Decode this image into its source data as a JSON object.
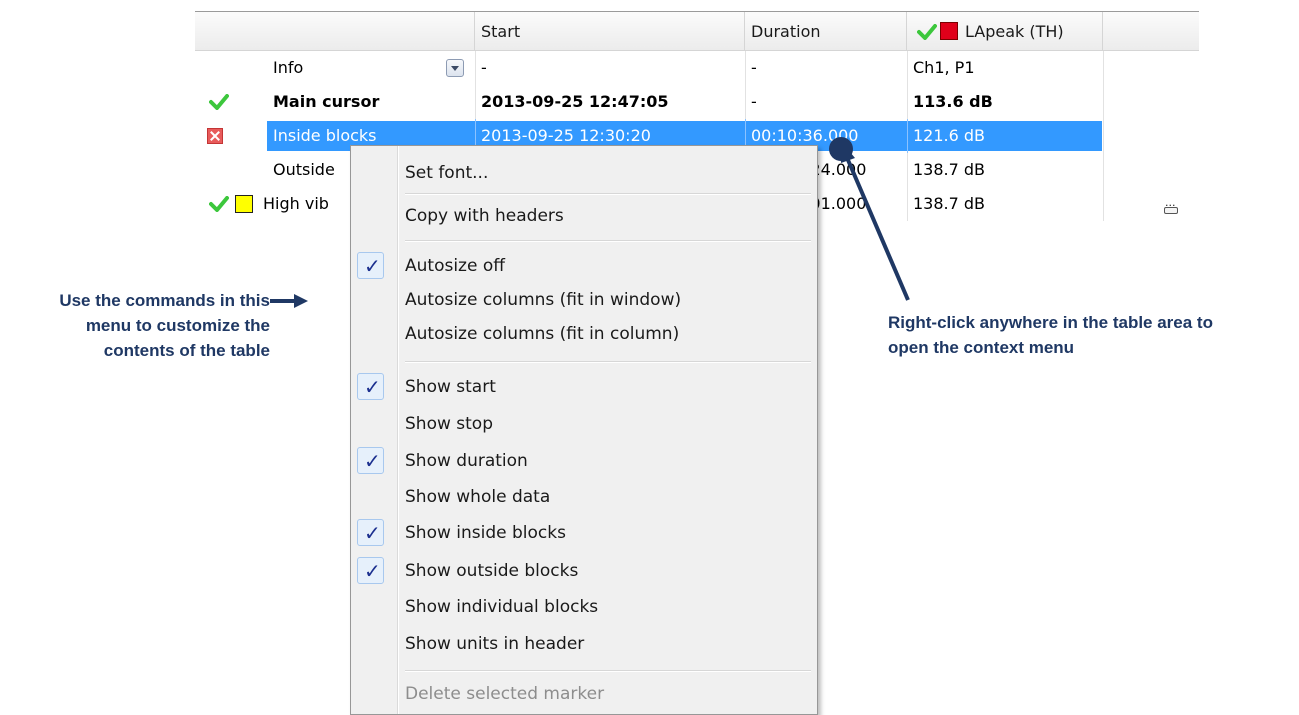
{
  "table": {
    "headers": {
      "start": "Start",
      "duration": "Duration",
      "lapeak": "LApeak (TH)"
    },
    "rows": [
      {
        "name": "Info",
        "start": "-",
        "duration": "-",
        "value": "Ch1, P1"
      },
      {
        "name": "Main cursor",
        "start": "2013-09-25 12:47:05",
        "duration": "-",
        "value": "113.6 dB"
      },
      {
        "name": "Inside blocks",
        "start": "2013-09-25 12:30:20",
        "duration": "00:10:36.000",
        "value": "121.6 dB"
      },
      {
        "name": "Outside",
        "start": "",
        "duration": ":24.000",
        "value": "138.7 dB"
      },
      {
        "name": "High vib",
        "start": "",
        "duration": ":01.000",
        "value": "138.7 dB"
      }
    ],
    "colors": {
      "check": "#3cc73c",
      "lapeak_marker": "#e0001a",
      "highvib_marker": "#ffff00",
      "selection": "#3399ff"
    }
  },
  "context_menu": {
    "items": [
      {
        "label": "Set font...",
        "checked": false
      },
      {
        "label": "Copy with headers",
        "checked": false
      },
      {
        "label": "Autosize off",
        "checked": true
      },
      {
        "label": "Autosize columns (fit in window)",
        "checked": false
      },
      {
        "label": "Autosize columns (fit in column)",
        "checked": false
      },
      {
        "label": "Show start",
        "checked": true
      },
      {
        "label": "Show stop",
        "checked": false
      },
      {
        "label": "Show duration",
        "checked": true
      },
      {
        "label": "Show whole data",
        "checked": false
      },
      {
        "label": "Show inside blocks",
        "checked": true
      },
      {
        "label": "Show outside blocks",
        "checked": true
      },
      {
        "label": "Show individual blocks",
        "checked": false
      },
      {
        "label": "Show units in header",
        "checked": false
      },
      {
        "label": "Delete selected marker",
        "checked": false,
        "disabled": true
      }
    ]
  },
  "annotations": {
    "left": [
      "Use the commands in this",
      "menu to customize the",
      "contents of the table"
    ],
    "right": [
      "Right-click anywhere in the table area to",
      "open the context menu"
    ],
    "color": "#1f3864"
  }
}
